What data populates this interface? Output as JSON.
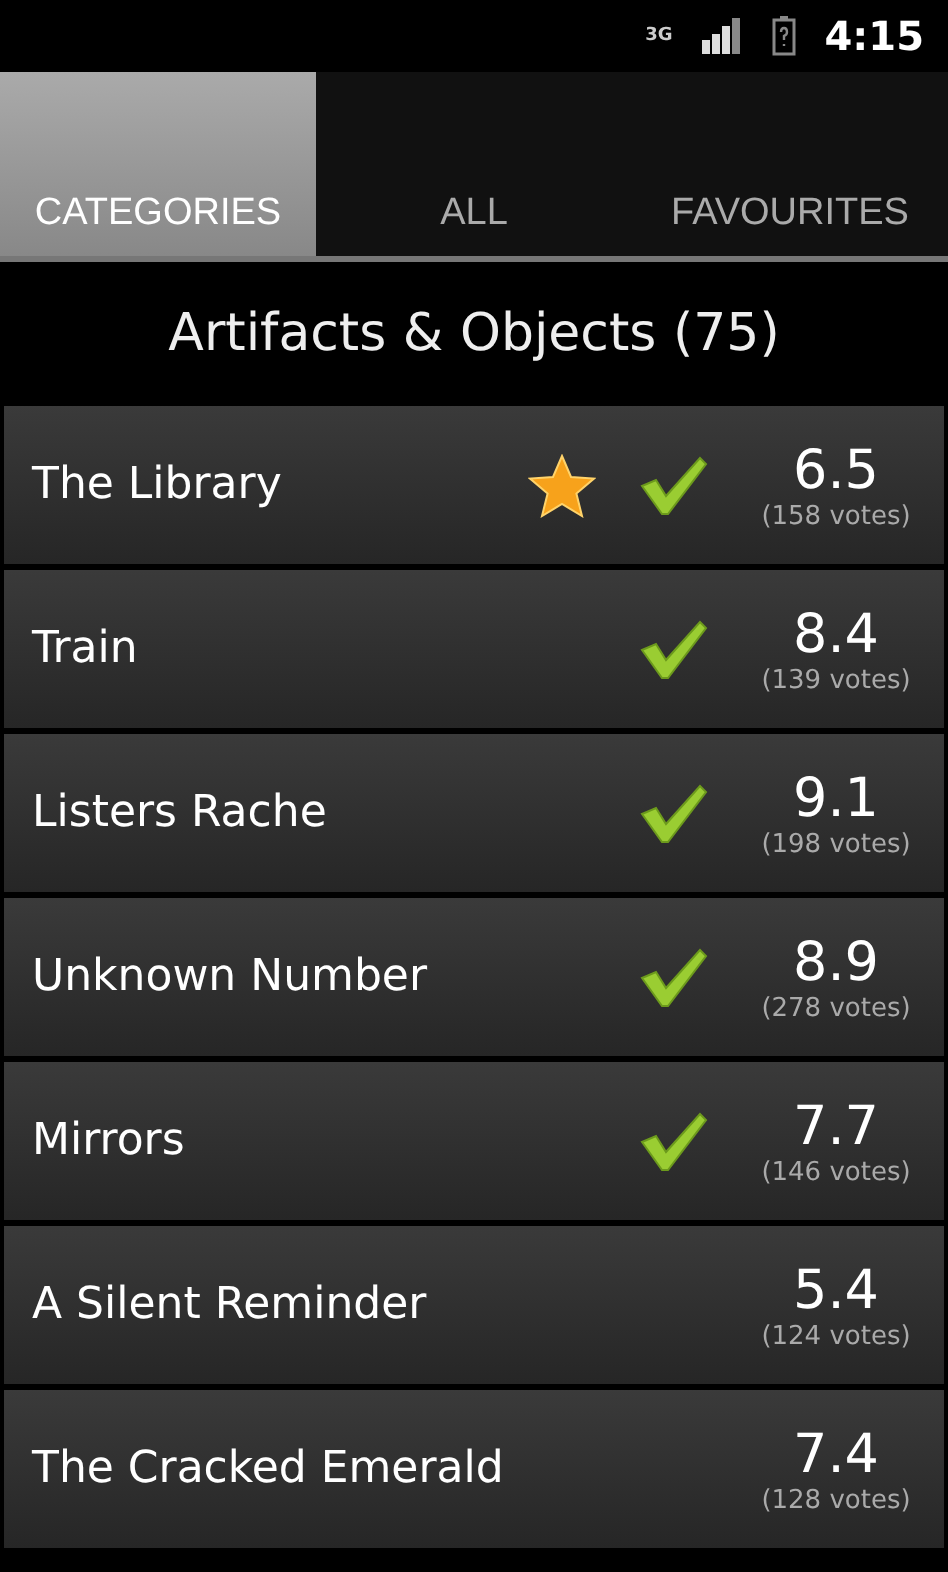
{
  "status_bar": {
    "network": "3G",
    "time": "4:15"
  },
  "tabs": [
    {
      "label": "CATEGORIES",
      "selected": true
    },
    {
      "label": "ALL",
      "selected": false
    },
    {
      "label": "FAVOURITES",
      "selected": false
    }
  ],
  "category": {
    "title": "Artifacts & Objects (75)"
  },
  "items": [
    {
      "title": "The Library",
      "favourite": true,
      "checked": true,
      "score": "6.5",
      "votes": "(158 votes)"
    },
    {
      "title": "Train",
      "favourite": false,
      "checked": true,
      "score": "8.4",
      "votes": "(139 votes)"
    },
    {
      "title": "Listers Rache",
      "favourite": false,
      "checked": true,
      "score": "9.1",
      "votes": "(198 votes)"
    },
    {
      "title": "Unknown Number",
      "favourite": false,
      "checked": true,
      "score": "8.9",
      "votes": "(278 votes)"
    },
    {
      "title": "Mirrors",
      "favourite": false,
      "checked": true,
      "score": "7.7",
      "votes": "(146 votes)"
    },
    {
      "title": "A Silent Reminder",
      "favourite": false,
      "checked": false,
      "score": "5.4",
      "votes": "(124 votes)"
    },
    {
      "title": "The Cracked Emerald",
      "favourite": false,
      "checked": false,
      "score": "7.4",
      "votes": "(128 votes)"
    }
  ]
}
